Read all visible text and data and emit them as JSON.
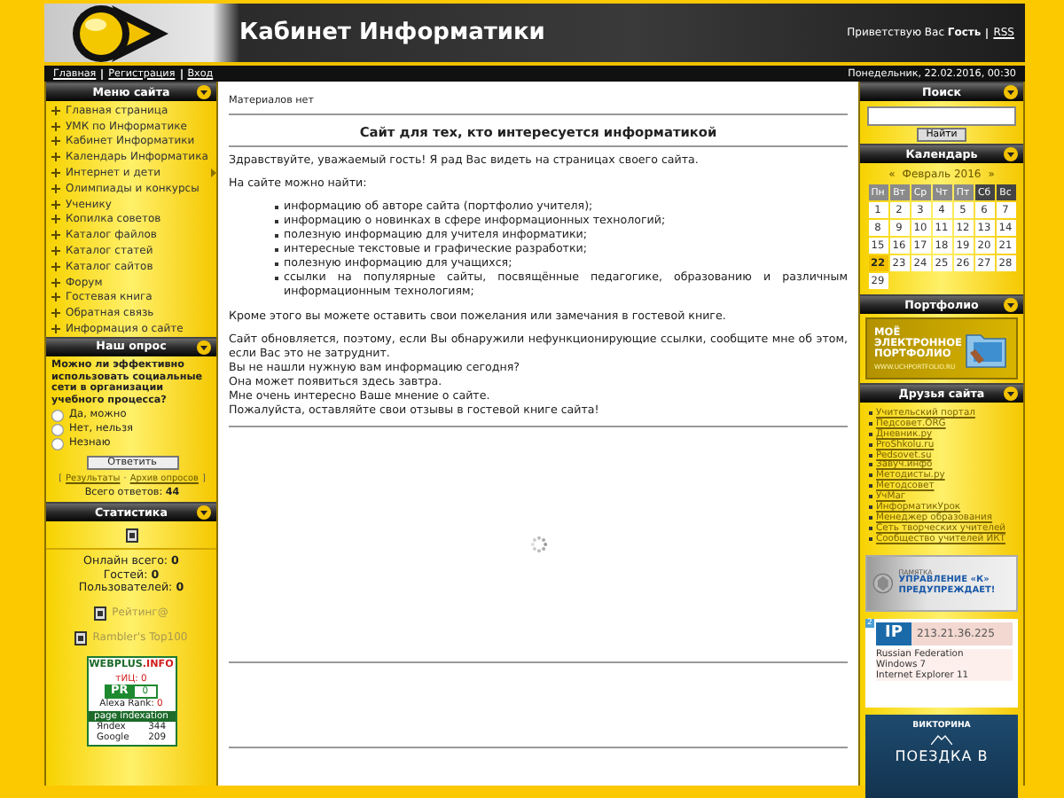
{
  "header": {
    "site_title": "Кабинет Информатики",
    "greeting": "Приветствую Вас **Гость**",
    "rss": "RSS"
  },
  "nav": {
    "links": [
      "Главная",
      "Регистрация",
      "Вход"
    ],
    "datetime": "Понедельник, 22.02.2016, 00:30"
  },
  "site_menu": {
    "title": "Меню сайта",
    "items": [
      {
        "label": "Главная страница",
        "has_submenu": false
      },
      {
        "label": "УМК по Информатике",
        "has_submenu": false
      },
      {
        "label": "Кабинет Информатики",
        "has_submenu": false
      },
      {
        "label": "Календарь Информатика",
        "has_submenu": false
      },
      {
        "label": "Интернет и дети",
        "has_submenu": true
      },
      {
        "label": "Олимпиады и конкурсы",
        "has_submenu": false
      },
      {
        "label": "Ученику",
        "has_submenu": false
      },
      {
        "label": "Копилка советов",
        "has_submenu": false
      },
      {
        "label": "Каталог файлов",
        "has_submenu": false
      },
      {
        "label": "Каталог статей",
        "has_submenu": false
      },
      {
        "label": "Каталог сайтов",
        "has_submenu": false
      },
      {
        "label": "Форум",
        "has_submenu": false
      },
      {
        "label": "Гостевая книга",
        "has_submenu": false
      },
      {
        "label": "Обратная связь",
        "has_submenu": false
      },
      {
        "label": "Информация о сайте",
        "has_submenu": false
      }
    ]
  },
  "poll": {
    "title": "Наш опрос",
    "question": "Можно ли эффективно использовать социальные сети в организации учебного процесса?",
    "options": [
      {
        "label": "Да, можно",
        "selected": false
      },
      {
        "label": "Нет, нельзя",
        "selected": false
      },
      {
        "label": "Незнаю",
        "selected": false
      }
    ],
    "submit": "Ответить",
    "bracket_open": "[",
    "links": [
      "Результаты",
      "Архив опросов"
    ],
    "link_separator": "·",
    "bracket_close": "]",
    "total": "Всего ответов: **44**"
  },
  "statistics": {
    "title": "Статистика",
    "online_total": "Онлайн всего: **0**",
    "guests": "Гостей: **0**",
    "users": "Пользователей: **0**",
    "counters": [
      "Рейтинг@",
      "Rambler's Top100"
    ]
  },
  "webplus_widget": {
    "logo_main": "WEBPLUS",
    "logo_suffix": ".INFO",
    "tic": "тИЦ: 0",
    "pr_label": "PR",
    "pr_value": "0",
    "alexa_label": "Alexa Rank:",
    "alexa_value": "0",
    "indexation_title": "page indexation",
    "engines": [
      {
        "name": "Яndex",
        "count": "344"
      },
      {
        "name": "Google",
        "count": "209"
      }
    ]
  },
  "content": {
    "notice": "Материалов нет",
    "heading": "Сайт для тех, кто интересуется информатикой",
    "intro": "Здравствуйте, уважаемый гость! Я рад Вас видеть на страницах своего сайта.",
    "list_intro": "На сайте можно найти:",
    "list_items": [
      "информацию об авторе сайта (портфолио учителя);",
      "информацию о новинках в сфере информационных технологий;",
      "полезную информацию для учителя информатики;",
      "интересные текстовые и графические разработки;",
      "полезную информацию для учащихся;",
      "ссылки на популярные сайты, посвящённые педагогике, образованию и различным информационным технологиям;"
    ],
    "guestbook_note": "Кроме этого вы можете оставить свои пожелания или замечания в гостевой книге.",
    "closing_lines": [
      "Сайт обновляется, поэтому, если Вы обнаружили нефункционирующие ссылки, сообщите мне об этом, если Вас это не затруднит.",
      "Вы не нашли нужную вам информацию сегодня?",
      "Она может появиться здесь завтра.",
      "Мне очень интересно Ваше мнение о сайте.",
      "Пожалуйста, оставляйте свои отзывы в гостевой книге сайта!"
    ]
  },
  "search": {
    "title": "Поиск",
    "button": "Найти"
  },
  "calendar": {
    "title": "Календарь",
    "prev": "«",
    "month": "Февраль 2016",
    "next": "»",
    "weekdays": [
      {
        "label": "Пн",
        "weekend": false
      },
      {
        "label": "Вт",
        "weekend": false
      },
      {
        "label": "Ср",
        "weekend": false
      },
      {
        "label": "Чт",
        "weekend": false
      },
      {
        "label": "Пт",
        "weekend": false
      },
      {
        "label": "Сб",
        "weekend": true
      },
      {
        "label": "Вс",
        "weekend": true
      }
    ],
    "days": [
      {
        "label": "1",
        "selected": false
      },
      {
        "label": "2",
        "selected": false
      },
      {
        "label": "3",
        "selected": false
      },
      {
        "label": "4",
        "selected": false
      },
      {
        "label": "5",
        "selected": false
      },
      {
        "label": "6",
        "selected": false
      },
      {
        "label": "7",
        "selected": false
      },
      {
        "label": "8",
        "selected": false
      },
      {
        "label": "9",
        "selected": false
      },
      {
        "label": "10",
        "selected": false
      },
      {
        "label": "11",
        "selected": false
      },
      {
        "label": "12",
        "selected": false
      },
      {
        "label": "13",
        "selected": false
      },
      {
        "label": "14",
        "selected": false
      },
      {
        "label": "15",
        "selected": false
      },
      {
        "label": "16",
        "selected": false
      },
      {
        "label": "17",
        "selected": false
      },
      {
        "label": "18",
        "selected": false
      },
      {
        "label": "19",
        "selected": false
      },
      {
        "label": "20",
        "selected": false
      },
      {
        "label": "21",
        "selected": false
      },
      {
        "label": "22",
        "selected": true
      },
      {
        "label": "23",
        "selected": false
      },
      {
        "label": "24",
        "selected": false
      },
      {
        "label": "25",
        "selected": false
      },
      {
        "label": "26",
        "selected": false
      },
      {
        "label": "27",
        "selected": false
      },
      {
        "label": "28",
        "selected": false
      },
      {
        "label": "29",
        "selected": false
      }
    ]
  },
  "portfolio": {
    "title": "Портфолио",
    "banner_lines": [
      "МОЁ",
      "ЭЛЕКТРОННОЕ",
      "ПОРТФОЛИО"
    ],
    "banner_url": "WWW.UCHPORTFOLIO.RU"
  },
  "friends": {
    "title": "Друзья сайта",
    "links": [
      "Учительский портал",
      "Педсовет.ORG",
      "Дневник.ру",
      "ProShkolu.ru",
      "Pedsovet.su",
      "Завуч.инфо",
      "Методисты.ру",
      "Методсовет",
      "УчМаг",
      "ИнформатикУрок",
      "Менеджер образования",
      "Сеть творческих учителей",
      "Сообщество учителей ИКТ"
    ]
  },
  "memo_banner": {
    "label": "ПАМЯТКА",
    "headline": "УПРАВЛЕНИЕ «К» ПРЕДУПРЕЖДАЕТ!"
  },
  "ip_widget": {
    "badge": "2",
    "logo": "IP",
    "address": "213.21.36.225",
    "country": "Russian Federation",
    "os": "Windows 7",
    "browser": "Internet Explorer 11"
  },
  "quiz_banner": {
    "label": "ВИКТОРИНА",
    "headline": "ПОЕЗДКА В"
  }
}
